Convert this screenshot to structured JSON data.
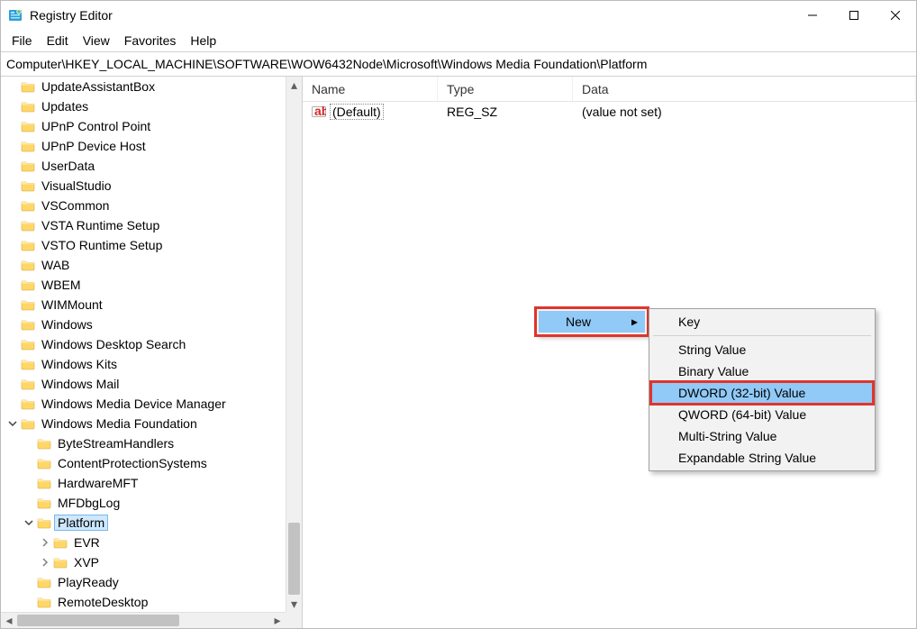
{
  "window": {
    "title": "Registry Editor"
  },
  "menubar": {
    "file": "File",
    "edit": "Edit",
    "view": "View",
    "favorites": "Favorites",
    "help": "Help"
  },
  "address": "Computer\\HKEY_LOCAL_MACHINE\\SOFTWARE\\WOW6432Node\\Microsoft\\Windows Media Foundation\\Platform",
  "tree": {
    "items": [
      {
        "label": "UpdateAssistantBox",
        "indent": 0
      },
      {
        "label": "Updates",
        "indent": 0
      },
      {
        "label": "UPnP Control Point",
        "indent": 0
      },
      {
        "label": "UPnP Device Host",
        "indent": 0
      },
      {
        "label": "UserData",
        "indent": 0
      },
      {
        "label": "VisualStudio",
        "indent": 0
      },
      {
        "label": "VSCommon",
        "indent": 0
      },
      {
        "label": "VSTA Runtime Setup",
        "indent": 0
      },
      {
        "label": "VSTO Runtime Setup",
        "indent": 0
      },
      {
        "label": "WAB",
        "indent": 0
      },
      {
        "label": "WBEM",
        "indent": 0
      },
      {
        "label": "WIMMount",
        "indent": 0
      },
      {
        "label": "Windows",
        "indent": 0
      },
      {
        "label": "Windows Desktop Search",
        "indent": 0
      },
      {
        "label": "Windows Kits",
        "indent": 0
      },
      {
        "label": "Windows Mail",
        "indent": 0
      },
      {
        "label": "Windows Media Device Manager",
        "indent": 0
      },
      {
        "label": "Windows Media Foundation",
        "indent": 0,
        "expanded": true
      },
      {
        "label": "ByteStreamHandlers",
        "indent": 1
      },
      {
        "label": "ContentProtectionSystems",
        "indent": 1
      },
      {
        "label": "HardwareMFT",
        "indent": 1
      },
      {
        "label": "MFDbgLog",
        "indent": 1
      },
      {
        "label": "Platform",
        "indent": 1,
        "selected": true,
        "expanded": true
      },
      {
        "label": "EVR",
        "indent": 2,
        "expander": ">"
      },
      {
        "label": "XVP",
        "indent": 2,
        "expander": ">"
      },
      {
        "label": "PlayReady",
        "indent": 1
      },
      {
        "label": "RemoteDesktop",
        "indent": 1
      }
    ]
  },
  "listheader": {
    "name": "Name",
    "type": "Type",
    "data": "Data"
  },
  "rows": [
    {
      "name": "(Default)",
      "type": "REG_SZ",
      "data": "(value not set)"
    }
  ],
  "ctx_first": {
    "new": "New"
  },
  "ctx_sub": {
    "key": "Key",
    "string": "String Value",
    "binary": "Binary Value",
    "dword": "DWORD (32-bit) Value",
    "qword": "QWORD (64-bit) Value",
    "multi": "Multi-String Value",
    "expand": "Expandable String Value"
  }
}
